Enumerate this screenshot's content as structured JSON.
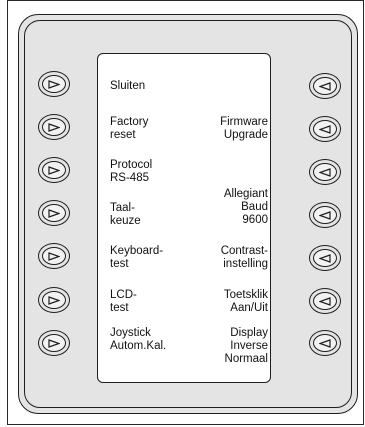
{
  "left_menu": [
    {
      "label": "Sluiten"
    },
    {
      "label": "Factory\nreset"
    },
    {
      "label": "Protocol\nRS-485"
    },
    {
      "label": "Taal-\nkeuze"
    },
    {
      "label": "Keyboard-\ntest"
    },
    {
      "label": "LCD-\ntest"
    },
    {
      "label": "Joystick\nAutom.Kal."
    }
  ],
  "right_menu": [
    {
      "label": ""
    },
    {
      "label": "Firmware\nUpgrade"
    },
    {
      "label": ""
    },
    {
      "label": "Allegiant\nBaud\n9600"
    },
    {
      "label": "Contrast-\ninstelling"
    },
    {
      "label": "Toetsklik\nAan/Uit"
    },
    {
      "label": "Display\nInverse\nNormaal"
    }
  ],
  "icons": {
    "left_buttons": "play-right-icon",
    "right_buttons": "play-left-icon"
  },
  "colors": {
    "device_body": "#e4e4e4",
    "outline": "#1e1e1e",
    "screen": "#ffffff"
  }
}
